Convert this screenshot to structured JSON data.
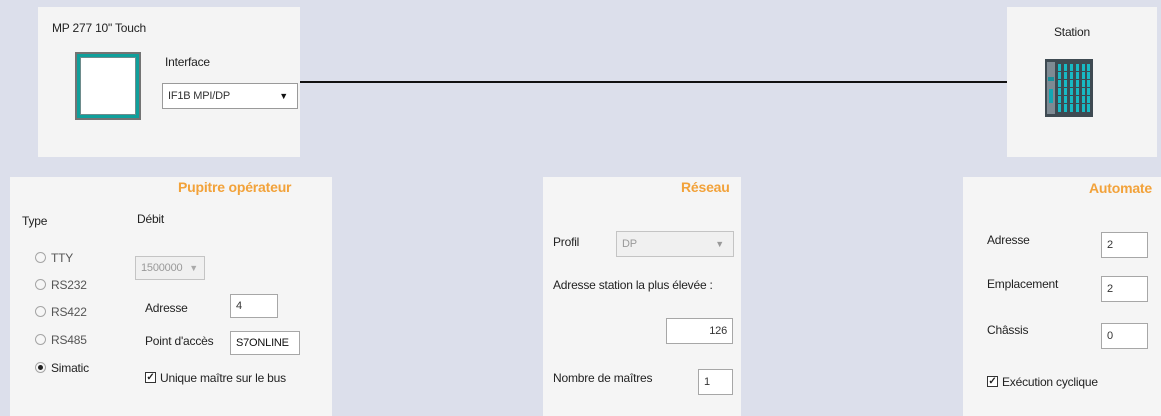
{
  "hmi": {
    "device_name": "MP 277 10\" Touch",
    "interface_label": "Interface",
    "interface_value": "IF1B MPI/DP",
    "dropdown_icon": "triangle-down"
  },
  "station": {
    "label": "Station"
  },
  "operator_panel": {
    "title": "Pupitre opérateur",
    "type_label": "Type",
    "debit_label": "Débit",
    "debit_value": "1500000",
    "types": [
      "TTY",
      "RS232",
      "RS422",
      "RS485",
      "Simatic"
    ],
    "selected_type": "Simatic",
    "address_label": "Adresse",
    "address_value": "4",
    "access_point_label": "Point d'accès",
    "access_point_value": "S7ONLINE",
    "single_master_label": "Unique maître sur le bus",
    "single_master_checked": true
  },
  "network": {
    "title": "Réseau",
    "profile_label": "Profil",
    "profile_value": "DP",
    "highest_address_label": "Adresse station la plus élevée :",
    "highest_address_value": "126",
    "masters_label": "Nombre de maîtres",
    "masters_value": "1"
  },
  "plc": {
    "title": "Automate",
    "address_label": "Adresse",
    "address_value": "2",
    "slot_label": "Emplacement",
    "slot_value": "2",
    "rack_label": "Châssis",
    "rack_value": "0",
    "cyclic_label": "Exécution cyclique",
    "cyclic_checked": true
  },
  "colors": {
    "accent": "#f2a23a",
    "hmi_screen": "#00cccc",
    "background": "#dcdfeb"
  }
}
